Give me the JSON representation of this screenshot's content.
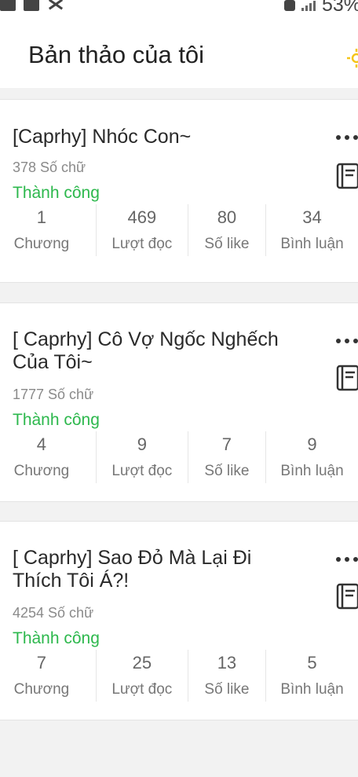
{
  "status_bar": {
    "battery_text": "53%"
  },
  "header": {
    "title": "Bản thảo của tôi",
    "action_icon": "sun-icon"
  },
  "stat_labels": {
    "chapters": "Chương",
    "reads": "Lượt đọc",
    "likes": "Số like",
    "comments": "Bình luận"
  },
  "drafts": [
    {
      "title": "[Caprhy] Nhóc Con~",
      "words": "378 Số chữ",
      "status": "Thành công",
      "chapters": "1",
      "reads": "469",
      "likes": "80",
      "comments": "34"
    },
    {
      "title": "[ Caprhy] Cô Vợ Ngốc Nghếch Của Tôi~",
      "words": "1777 Số chữ",
      "status": "Thành công",
      "chapters": "4",
      "reads": "9",
      "likes": "7",
      "comments": "9"
    },
    {
      "title": "[ Caprhy] Sao Đỏ Mà Lại Đi Thích Tôi Á?!",
      "words": "4254 Số chữ",
      "status": "Thành công",
      "chapters": "7",
      "reads": "25",
      "likes": "13",
      "comments": "5"
    }
  ],
  "colors": {
    "status_green": "#2db84d",
    "accent_yellow": "#f5c518"
  }
}
